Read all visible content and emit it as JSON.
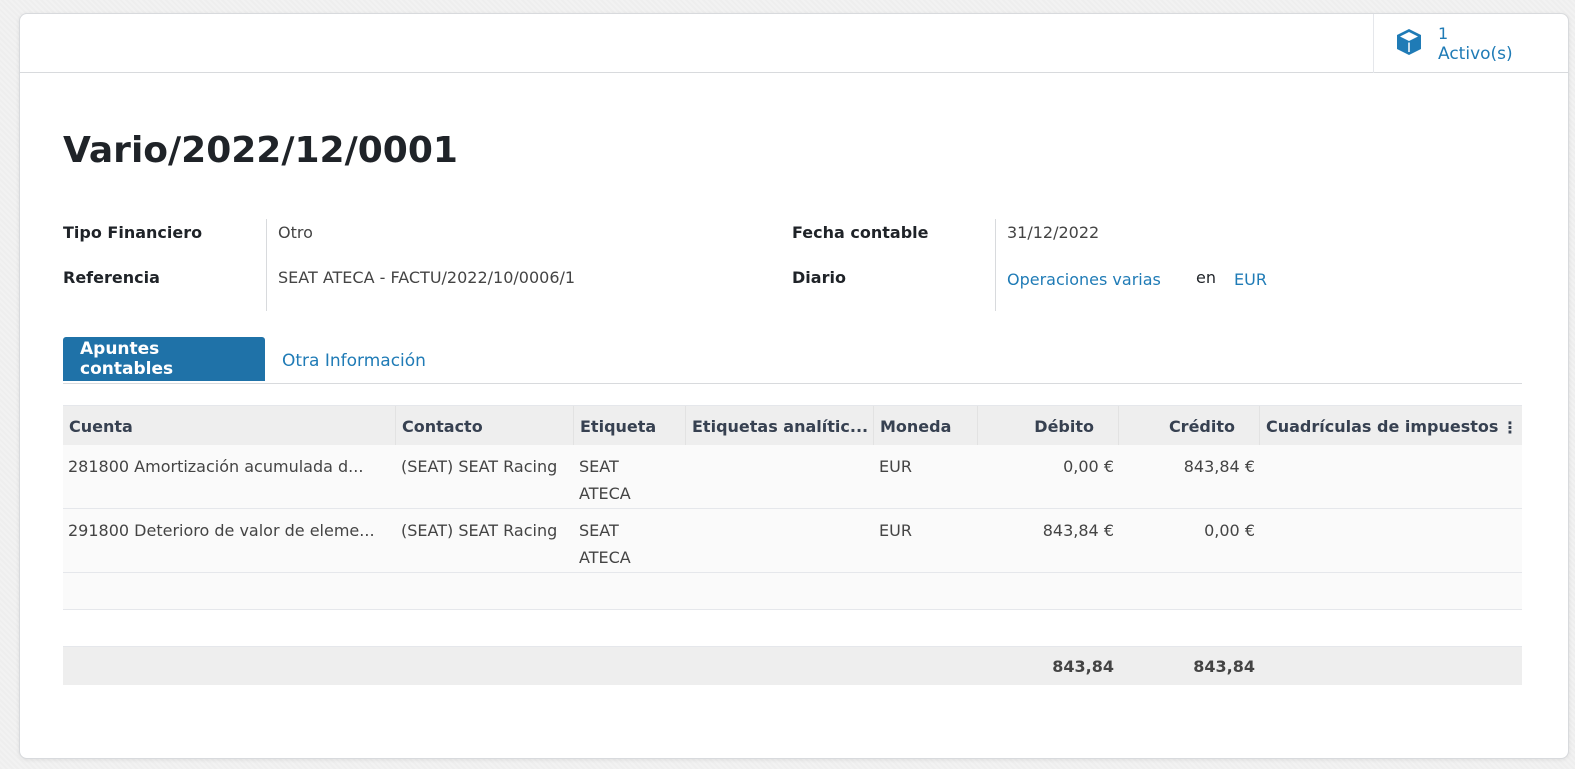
{
  "smart_button": {
    "value": "1",
    "label": "Activo(s)",
    "icon": "cube-icon"
  },
  "title": "Vario/2022/12/0001",
  "fields": {
    "tipo_financiero": {
      "label": "Tipo Financiero",
      "value": "Otro"
    },
    "referencia": {
      "label": "Referencia",
      "value": "SEAT ATECA - FACTU/2022/10/0006/1"
    },
    "fecha_contable": {
      "label": "Fecha contable",
      "value": "31/12/2022"
    },
    "diario": {
      "label": "Diario",
      "journal": "Operaciones varias",
      "in": "en",
      "currency": "EUR"
    }
  },
  "tabs": [
    {
      "label": "Apuntes contables",
      "active": true
    },
    {
      "label": "Otra Información",
      "active": false
    }
  ],
  "table": {
    "columns": [
      "Cuenta",
      "Contacto",
      "Etiqueta",
      "Etiquetas analític...",
      "Moneda",
      "Débito",
      "Crédito",
      "Cuadrículas de impuestos"
    ],
    "rows": [
      {
        "cuenta": "281800 Amortización acumulada d...",
        "contacto": "(SEAT) SEAT Racing",
        "etiqueta": "SEAT ATECA",
        "analiticas": "",
        "moneda": "EUR",
        "debito": "0,00 €",
        "credito": "843,84 €",
        "impuestos": ""
      },
      {
        "cuenta": "291800 Deterioro de valor de eleme...",
        "contacto": "(SEAT) SEAT Racing",
        "etiqueta": "SEAT ATECA",
        "analiticas": "",
        "moneda": "EUR",
        "debito": "843,84 €",
        "credito": "0,00 €",
        "impuestos": ""
      }
    ],
    "totals": {
      "debito": "843,84",
      "credito": "843,84"
    }
  },
  "colors": {
    "accent": "#1f72a8",
    "link": "#1f7bb6"
  }
}
